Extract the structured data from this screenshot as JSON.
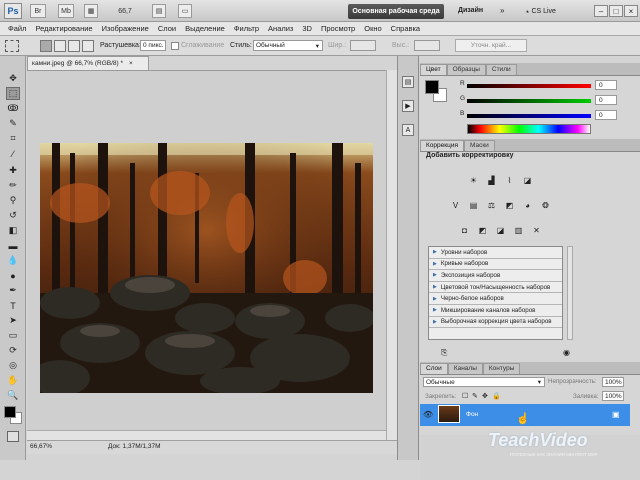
{
  "app": {
    "logo": "Ps",
    "toolbar_icons": [
      "Br",
      "Mb",
      "66,7"
    ],
    "workspace_active": "Основная рабочая среда",
    "workspace_link": "Дизайн",
    "cs_live": "CS Live"
  },
  "menu": [
    "Файл",
    "Редактирование",
    "Изображение",
    "Слои",
    "Выделение",
    "Фильтр",
    "Анализ",
    "3D",
    "Просмотр",
    "Окно",
    "Справка"
  ],
  "options": {
    "feather_label": "Растушевка:",
    "feather_value": "0 пикс.",
    "antialias_label": "Сглаживание",
    "style_label": "Стиль:",
    "style_value": "Обычный",
    "width_label": "Шир.:",
    "height_label": "Выс.:",
    "refine_button": "Уточн. край..."
  },
  "document": {
    "tab_title": "камни.jpeg @ 66,7% (RGB/8) *",
    "zoom": "66,67%",
    "doc_size": "Док: 1,37M/1,37M"
  },
  "color_panel": {
    "tabs": [
      "Цвет",
      "Образцы",
      "Стили"
    ],
    "channels": [
      {
        "label": "R",
        "value": "0",
        "color": "#d40000"
      },
      {
        "label": "G",
        "value": "0",
        "color": "#12a012"
      },
      {
        "label": "B",
        "value": "0",
        "color": "#1a2bd0"
      }
    ]
  },
  "adjustments_panel": {
    "tabs": [
      "Коррекция",
      "Маски"
    ],
    "title": "Добавить корректировку",
    "presets": [
      "Уровни наборов",
      "Кривые наборов",
      "Экспозиция наборов",
      "Цветовой тон/Насыщенность наборов",
      "Черно-белое наборов",
      "Микширование каналов наборов",
      "Выборочная коррекция цвета наборов"
    ]
  },
  "layers_panel": {
    "tabs": [
      "Слои",
      "Каналы",
      "Контуры"
    ],
    "blend_mode": "Обычные",
    "opacity_label": "Непрозрачность:",
    "opacity_value": "100%",
    "lock_label": "Закрепить:",
    "fill_label": "Заливка:",
    "fill_value": "100%",
    "layer_name": "Фон"
  },
  "watermark": {
    "brand": "TeachVideo",
    "tagline": "ПОЛЕЗНЫЕ КАК ЗНАНИЯ МЕНЯЮТ МИР"
  }
}
